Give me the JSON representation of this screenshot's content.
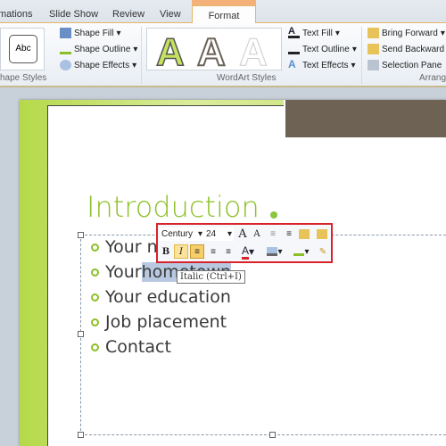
{
  "tabs": [
    "mations",
    "Slide Show",
    "Review",
    "View"
  ],
  "active_tab": "Format",
  "shape_styles": {
    "sample": "Abc",
    "fill": "Shape Fill",
    "outline": "Shape Outline",
    "effects": "Shape Effects",
    "label": "hape Styles"
  },
  "wordart": {
    "letter": "A",
    "fill": "Text Fill",
    "outline": "Text Outline",
    "effects": "Text Effects",
    "label": "WordArt Styles"
  },
  "arrange": {
    "forward": "Bring Forward",
    "backward": "Send Backward",
    "pane": "Selection Pane",
    "label": "Arrange"
  },
  "slide": {
    "title": "Introduction",
    "bullets": [
      "Your n",
      "Your ho",
      "Your education",
      "Job placement",
      "Contact"
    ],
    "selected_text": "hometown",
    "selected_prefix": "Your ",
    "selected_rest": "n"
  },
  "mini_toolbar": {
    "font": "Century",
    "size": "24",
    "bold": "B",
    "italic": "I"
  },
  "tooltip": "Italic (Ctrl+I)",
  "colors": {
    "accent": "#8cbf26",
    "highlight": "#d8232a"
  }
}
